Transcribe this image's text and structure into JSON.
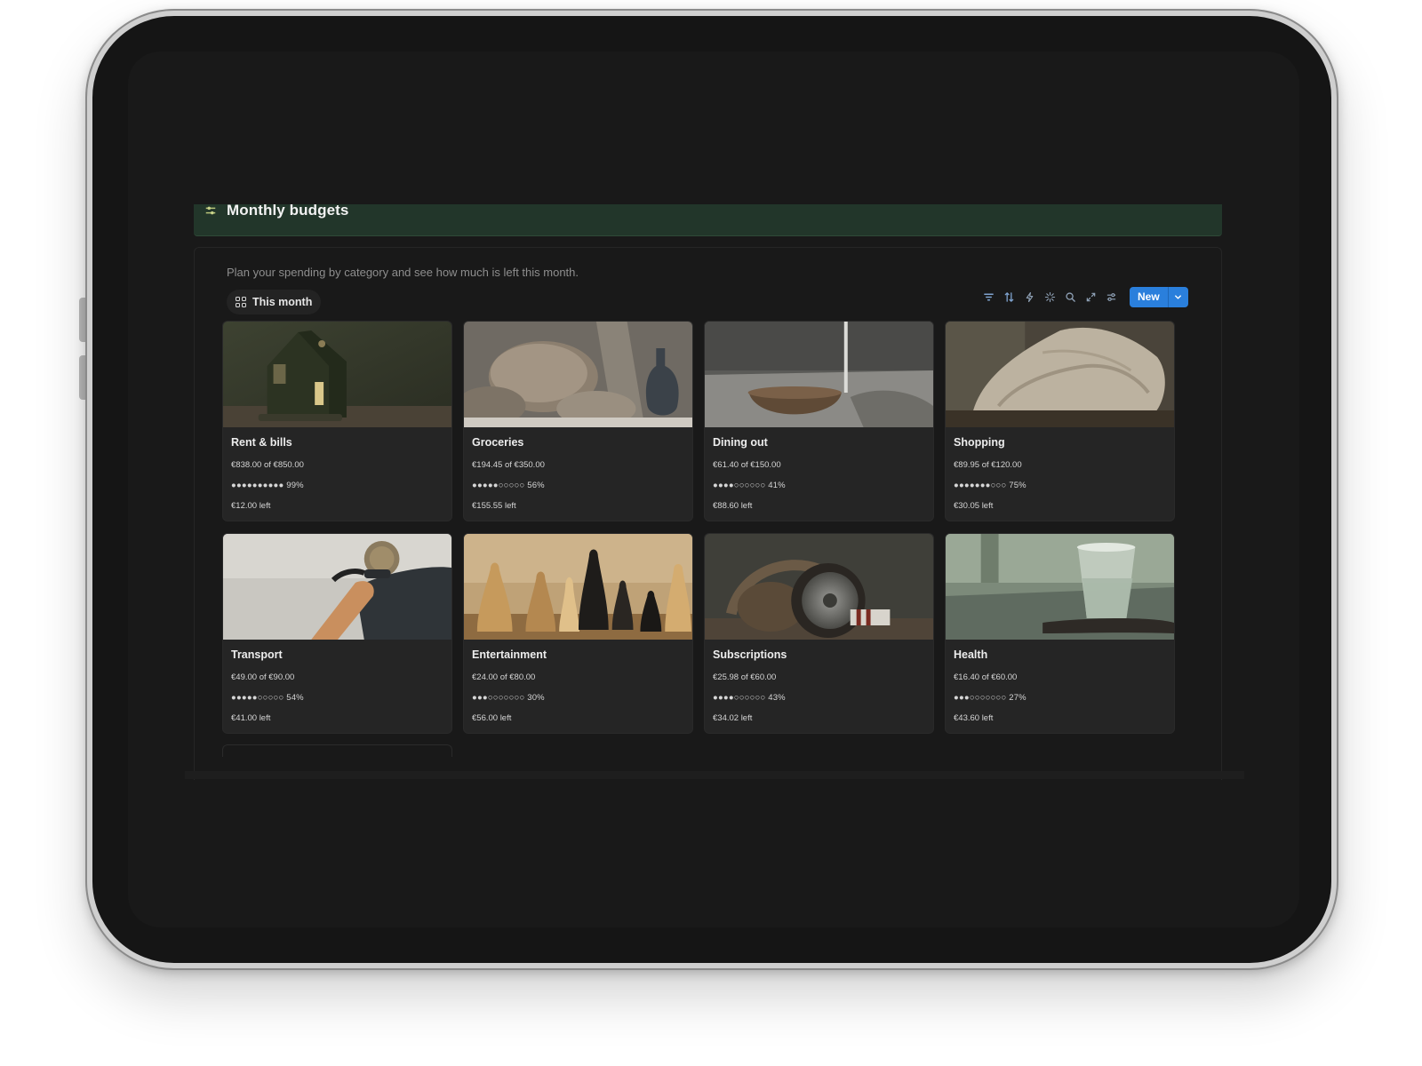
{
  "page": {
    "title": "Monthly budgets",
    "description": "Plan your spending by category and see how much is left this month."
  },
  "view": {
    "active_tab": "This month"
  },
  "toolbar": {
    "icons": [
      "filter-icon",
      "sort-icon",
      "automation-icon",
      "ai-sparkle-icon",
      "search-icon",
      "expand-icon",
      "settings-sliders-icon"
    ],
    "new_label": "New",
    "accent": "#2a7fdc"
  },
  "cards": [
    {
      "name": "Rent & bills",
      "amount": "€838.00 of €850.00",
      "progress": "●●●●●●●●●● 99%",
      "left": "€12.00 left",
      "cover": "house"
    },
    {
      "name": "Groceries",
      "amount": "€194.45 of €350.00",
      "progress": "●●●●●○○○○○ 56%",
      "left": "€155.55 left",
      "cover": "bread"
    },
    {
      "name": "Dining out",
      "amount": "€61.40 of €150.00",
      "progress": "●●●●○○○○○○ 41%",
      "left": "€88.60 left",
      "cover": "bowl"
    },
    {
      "name": "Shopping",
      "amount": "€89.95 of €120.00",
      "progress": "●●●●●●●○○○ 75%",
      "left": "€30.05 left",
      "cover": "sweater"
    },
    {
      "name": "Transport",
      "amount": "€49.00 of €90.00",
      "progress": "●●●●●○○○○○ 54%",
      "left": "€41.00 left",
      "cover": "bike"
    },
    {
      "name": "Entertainment",
      "amount": "€24.00 of €80.00",
      "progress": "●●●○○○○○○○ 30%",
      "left": "€56.00 left",
      "cover": "chess"
    },
    {
      "name": "Subscriptions",
      "amount": "€25.98 of €60.00",
      "progress": "●●●●○○○○○○ 43%",
      "left": "€34.02 left",
      "cover": "headphones"
    },
    {
      "name": "Health",
      "amount": "€16.40 of €60.00",
      "progress": "●●●○○○○○○○ 27%",
      "left": "€43.60 left",
      "cover": "glass"
    }
  ]
}
